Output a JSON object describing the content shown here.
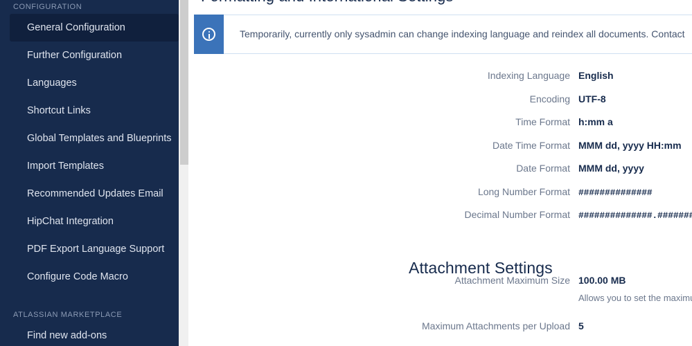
{
  "sidebar": {
    "sections": [
      {
        "title": "CONFIGURATION",
        "items": [
          {
            "label": "General Configuration",
            "selected": true
          },
          {
            "label": "Further Configuration",
            "selected": false
          },
          {
            "label": "Languages",
            "selected": false
          },
          {
            "label": "Shortcut Links",
            "selected": false
          },
          {
            "label": "Global Templates and Blueprints",
            "selected": false
          },
          {
            "label": "Import Templates",
            "selected": false
          },
          {
            "label": "Recommended Updates Email",
            "selected": false
          },
          {
            "label": "HipChat Integration",
            "selected": false
          },
          {
            "label": "PDF Export Language Support",
            "selected": false
          },
          {
            "label": "Configure Code Macro",
            "selected": false
          }
        ]
      },
      {
        "title": "ATLASSIAN MARKETPLACE",
        "items": [
          {
            "label": "Find new add-ons",
            "selected": false
          }
        ]
      }
    ],
    "scrollbar": {
      "name": "sidebar-scrollbar"
    }
  },
  "main": {
    "clipped_heading": "Formatting and International Settings",
    "banner": {
      "icon": "info-icon",
      "accent_color": "#3b73b9",
      "text": "Temporarily, currently only sysadmin can change indexing language and reindex all documents. Contact"
    },
    "settings_rows": [
      {
        "label": "Indexing Language",
        "value": "English",
        "mono": false
      },
      {
        "label": "Encoding",
        "value": "UTF-8",
        "mono": false
      },
      {
        "label": "Time Format",
        "value": "h:mm a",
        "mono": false
      },
      {
        "label": "Date Time Format",
        "value": "MMM dd, yyyy HH:mm",
        "mono": false
      },
      {
        "label": "Date Format",
        "value": "MMM dd, yyyy",
        "mono": false
      },
      {
        "label": "Long Number Format",
        "value": "##############",
        "mono": true
      },
      {
        "label": "Decimal Number Format",
        "value": "##############.##########",
        "mono": true
      }
    ],
    "attachment_settings": {
      "heading": "Attachment Settings",
      "rows": [
        {
          "label": "Attachment Maximum Size",
          "value": "100.00 MB",
          "help": "Allows you to set the maximum size for each attachment uploaded to the site."
        },
        {
          "label": "Maximum Attachments per Upload",
          "value": "5",
          "help": ""
        }
      ]
    }
  },
  "colors": {
    "sidebar_bg": "#172b4d",
    "sidebar_selected_bg": "#10203d",
    "banner_accent": "#3b73b9",
    "text_muted": "#6b778c",
    "text_strong": "#172b4d"
  }
}
